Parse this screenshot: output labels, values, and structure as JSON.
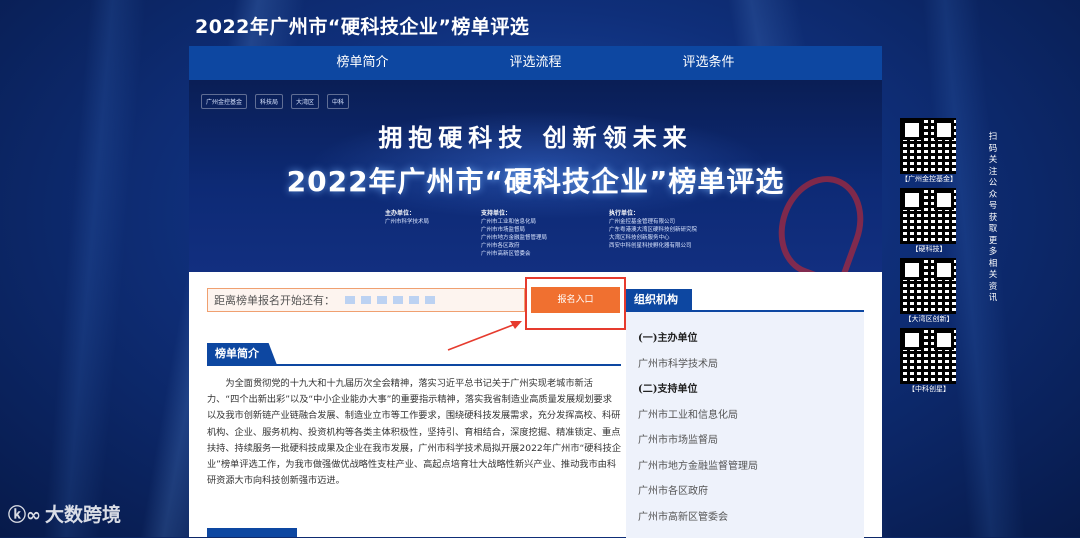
{
  "site": {
    "title": "2022年广州市“硬科技企业”榜单评选"
  },
  "nav": {
    "items": [
      "榜单简介",
      "评选流程",
      "评选条件"
    ]
  },
  "banner": {
    "logos": [
      "广州金控基金",
      "科技局",
      "大湾区",
      "中科"
    ],
    "slogan": "拥抱硬科技  创新领未来",
    "title": "2022年广州市“硬科技企业”榜单评选",
    "host_head": "主办单位：",
    "host": [
      "广州市科学技术局"
    ],
    "support_head": "支持单位：",
    "support": [
      "广州市工业和信息化局",
      "广州市市场监督局",
      "广州市地方金融监督管理局",
      "广州市各区政府",
      "广州市高新区管委会"
    ],
    "exec_head": "执行单位：",
    "exec": [
      "广州金控基金管理有限公司",
      "广东粤港澳大湾区硬科技创新研究院",
      "大湾区科技创新服务中心",
      "西安中科创星科技孵化器有限公司"
    ]
  },
  "signup": {
    "countdown_label": "距离榜单报名开始还有：",
    "button_label": "报名入口"
  },
  "intro": {
    "tab_label": "榜单简介",
    "text": "为全面贯彻党的十九大和十九届历次全会精神，落实习近平总书记关于广州实现老城市新活力、“四个出新出彩”以及“中小企业能办大事”的重要指示精神，落实我省制造业高质量发展规划要求以及我市创新链产业链融合发展、制造业立市等工作要求，围绕硬科技发展需求，充分发挥高校、科研机构、企业、服务机构、投资机构等各类主体积极性，坚持引、育相结合，深度挖掘、精准锁定、重点扶持、持续服务一批硬科技成果及企业在我市发展，广州市科学技术局拟开展2022年广州市“硬科技企业”榜单评选工作，为我市做强做优战略性支柱产业、高起点培育壮大战略性新兴产业、推动我市由科研资源大市向科技创新强市迈进。"
  },
  "orgs_panel": {
    "tab_label": "组织机构",
    "items": [
      {
        "label": "(一)主办单位",
        "group": true
      },
      {
        "label": "广州市科学技术局",
        "group": false
      },
      {
        "label": "(二)支持单位",
        "group": true
      },
      {
        "label": "广州市工业和信息化局",
        "group": false
      },
      {
        "label": "广州市市场监督局",
        "group": false
      },
      {
        "label": "广州市地方金融监督管理局",
        "group": false
      },
      {
        "label": "广州市各区政府",
        "group": false
      },
      {
        "label": "广州市高新区管委会",
        "group": false
      }
    ]
  },
  "qr_codes": [
    {
      "label": "【广州金控基金】"
    },
    {
      "label": "【硬科技】"
    },
    {
      "label": "【大湾区创新】"
    },
    {
      "label": "【中科创星】"
    }
  ],
  "qr_caption": "扫码关注公众号获取更多相关资讯",
  "watermark": {
    "text": "大数跨境"
  }
}
